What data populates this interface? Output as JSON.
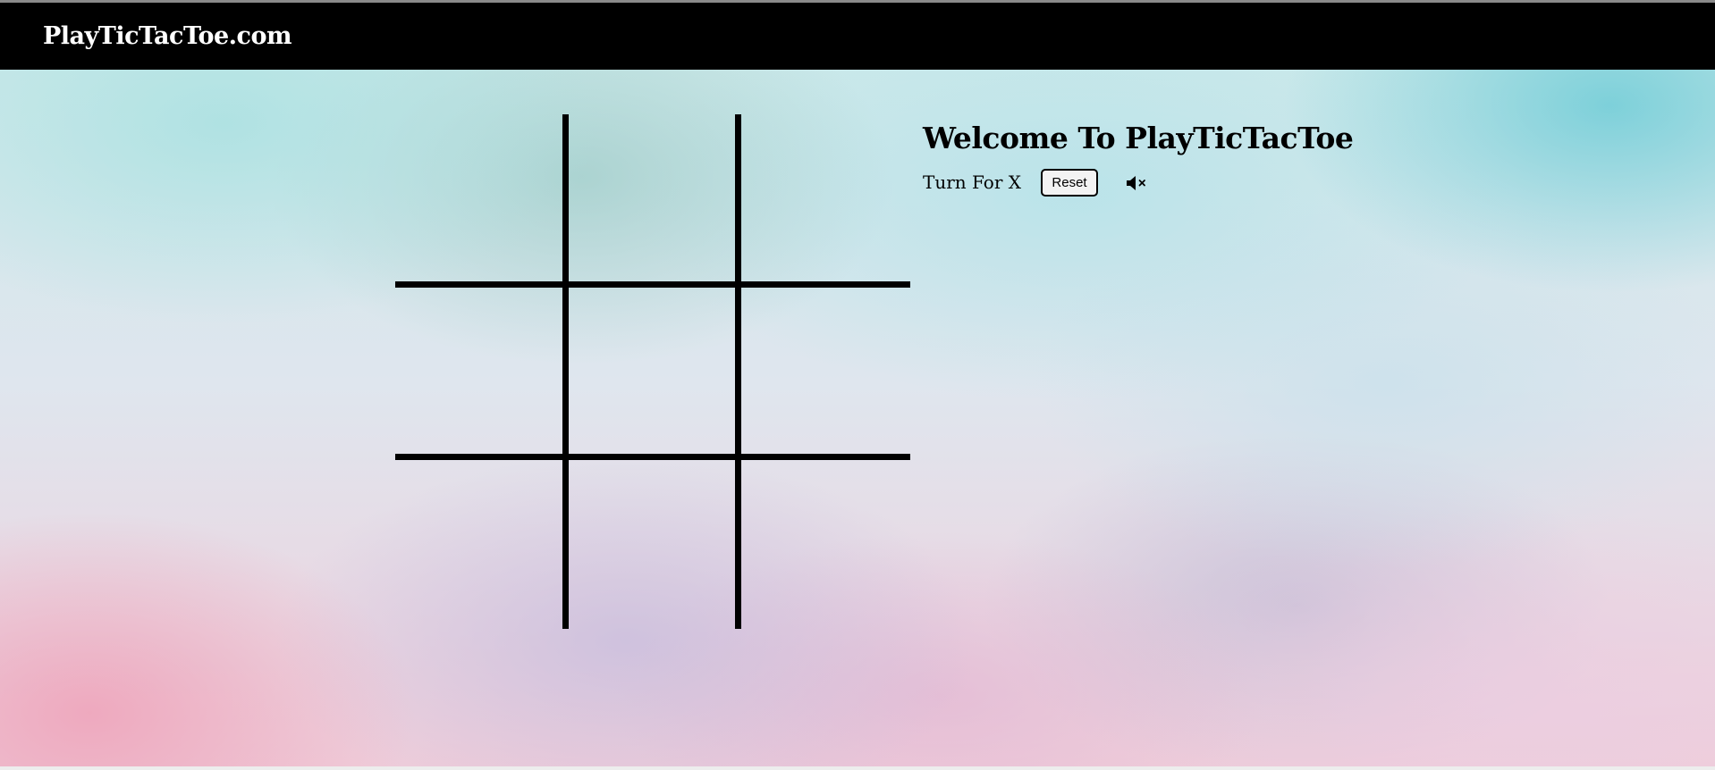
{
  "navbar": {
    "brand": "PlayTicTacToe.com"
  },
  "game": {
    "title": "Welcome To PlayTicTacToe",
    "turn_text": "Turn For X",
    "reset_label": "Reset",
    "sound_icon": "speaker-muted-icon",
    "board": [
      "",
      "",
      "",
      "",
      "",
      "",
      "",
      "",
      ""
    ]
  },
  "colors": {
    "navbar_bg": "#000000",
    "brand_text": "#ffffff",
    "grid_lines": "#000000"
  }
}
